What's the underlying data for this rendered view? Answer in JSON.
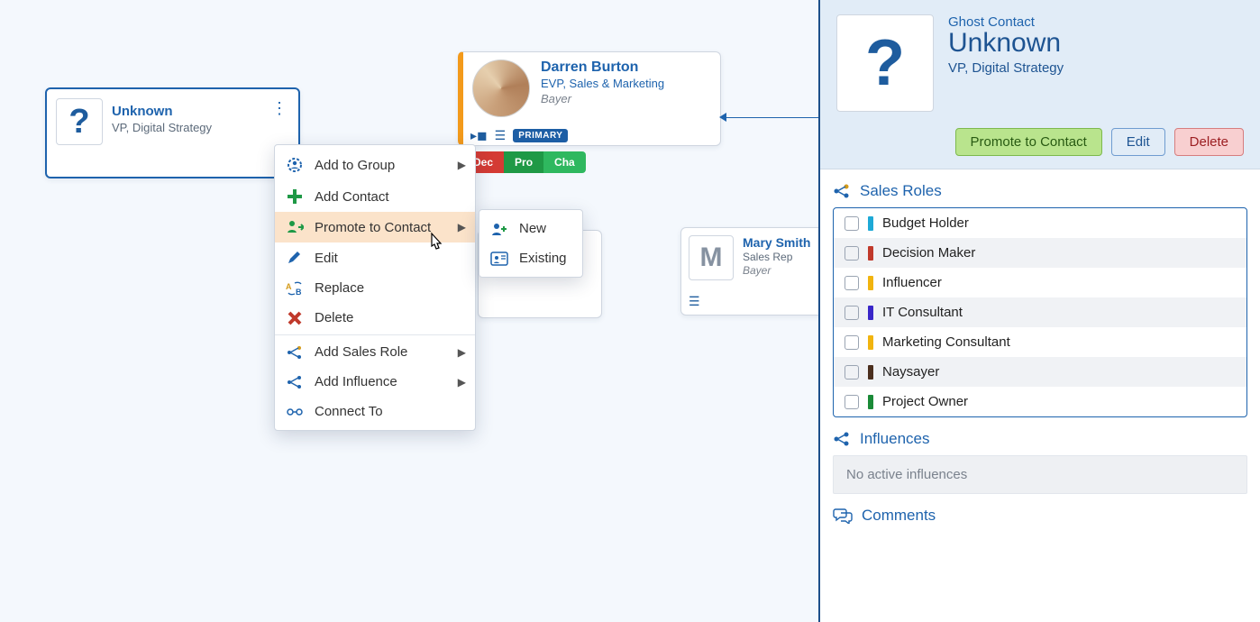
{
  "canvas": {
    "ghost": {
      "name": "Unknown",
      "title": "VP, Digital Strategy"
    },
    "darren": {
      "name": "Darren Burton",
      "title": "EVP, Sales & Marketing",
      "company": "Bayer",
      "badge": "PRIMARY",
      "roles": {
        "dec": "Dec",
        "pro": "Pro",
        "cha": "Cha"
      }
    },
    "mary": {
      "initial": "M",
      "name": "Mary Smith",
      "title": "Sales Rep",
      "company": "Bayer"
    }
  },
  "menu": {
    "add_to_group": "Add to Group",
    "add_contact": "Add Contact",
    "promote": "Promote to Contact",
    "edit": "Edit",
    "replace": "Replace",
    "delete": "Delete",
    "add_sales_role": "Add Sales Role",
    "add_influence": "Add Influence",
    "connect_to": "Connect To",
    "sub_new": "New",
    "sub_existing": "Existing"
  },
  "panel": {
    "type_label": "Ghost Contact",
    "name": "Unknown",
    "title": "VP, Digital Strategy",
    "btn_promote": "Promote to Contact",
    "btn_edit": "Edit",
    "btn_delete": "Delete",
    "section_roles": "Sales Roles",
    "roles": [
      {
        "label": "Budget Holder",
        "color": "#1ea9d6"
      },
      {
        "label": "Decision Maker",
        "color": "#c0392b"
      },
      {
        "label": "Influencer",
        "color": "#f1b40f"
      },
      {
        "label": "IT Consultant",
        "color": "#3926c8"
      },
      {
        "label": "Marketing Consultant",
        "color": "#f1b40f"
      },
      {
        "label": "Naysayer",
        "color": "#4a2e1d"
      },
      {
        "label": "Project Owner",
        "color": "#1a8a37"
      }
    ],
    "section_influences": "Influences",
    "no_influences": "No active influences",
    "section_comments": "Comments"
  }
}
